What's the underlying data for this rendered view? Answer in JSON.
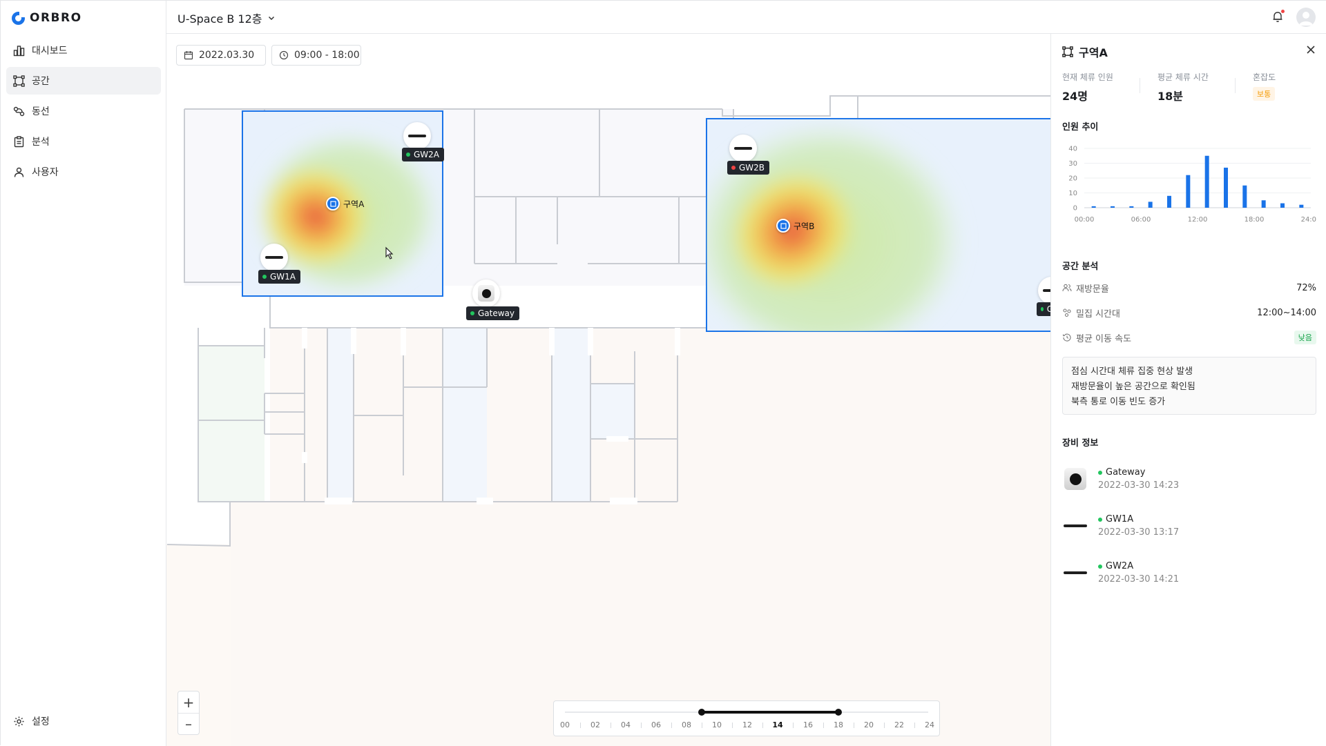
{
  "app": {
    "logo": "ORBRO"
  },
  "sidebar": {
    "items": [
      {
        "label": "대시보드",
        "icon": "bar-chart-icon"
      },
      {
        "label": "공간",
        "icon": "zone-icon",
        "active": true
      },
      {
        "label": "동선",
        "icon": "route-icon"
      },
      {
        "label": "분석",
        "icon": "clipboard-icon"
      },
      {
        "label": "사용자",
        "icon": "user-icon"
      }
    ],
    "settings_label": "설정"
  },
  "header": {
    "floor": "U-Space B 12층"
  },
  "filters": {
    "date": "2022.03.30",
    "time": "09:00 - 18:00"
  },
  "map": {
    "zones": [
      {
        "name": "구역A"
      },
      {
        "name": "구역B"
      }
    ],
    "devices": [
      {
        "name": "GW2A",
        "status": "online"
      },
      {
        "name": "GW1A",
        "status": "online"
      },
      {
        "name": "Gateway",
        "status": "online"
      },
      {
        "name": "GW2B",
        "status": "offline"
      },
      {
        "name": "G",
        "status": "online"
      }
    ],
    "status_colors": {
      "online": "#22c55e",
      "offline": "#ef4444"
    },
    "zoom": {
      "in": "+",
      "out": "–"
    },
    "timeline": {
      "labels": [
        "00",
        "02",
        "04",
        "06",
        "08",
        "10",
        "12",
        "14",
        "16",
        "18",
        "20",
        "22",
        "24"
      ],
      "current": "14",
      "range_start_hour": 9,
      "range_end_hour": 18
    }
  },
  "panel": {
    "title": "구역A",
    "stats": {
      "current_label": "현재 체류 인원",
      "current_value": "24명",
      "avg_label": "평균 체류 시간",
      "avg_value": "18분",
      "congestion_label": "혼잡도",
      "congestion_value": "보통"
    },
    "trend_title": "인원 추이",
    "analysis_title": "공간 분석",
    "analysis": [
      {
        "label": "재방문율",
        "value": "72%",
        "icon": "people-icon"
      },
      {
        "label": "밀집 시간대",
        "value": "12:00~14:00",
        "icon": "cluster-icon"
      },
      {
        "label": "평균 이동 속도",
        "value": "낮음",
        "icon": "clock-history-icon"
      }
    ],
    "notes": [
      "점심 시간대 체류 집중 현상 발생",
      "재방문율이 높은 공간으로 확인됨",
      "북측 통로 이동 빈도 증가"
    ],
    "equipment_title": "장비 정보",
    "equipment": [
      {
        "name": "Gateway",
        "time": "2022-03-30 14:23",
        "type": "gateway"
      },
      {
        "name": "GW1A",
        "time": "2022-03-30 13:17",
        "type": "bar"
      },
      {
        "name": "GW2A",
        "time": "2022-03-30 14:21",
        "type": "bar"
      }
    ]
  },
  "chart_data": {
    "type": "bar",
    "x": [
      0,
      2,
      4,
      6,
      8,
      10,
      12,
      14,
      16,
      18,
      20,
      22,
      24
    ],
    "values": [
      1,
      1,
      1,
      4,
      8,
      22,
      35,
      27,
      15,
      5,
      3,
      2
    ],
    "bar_x": [
      0,
      2,
      4,
      6,
      8,
      10,
      12,
      14,
      16,
      18,
      20,
      22
    ],
    "xticks": [
      "00:00",
      "06:00",
      "12:00",
      "18:00",
      "24:00"
    ],
    "yticks": [
      0,
      10,
      20,
      30,
      40
    ],
    "ylim": [
      0,
      40
    ],
    "color": "#1a73e8",
    "grid": true
  }
}
